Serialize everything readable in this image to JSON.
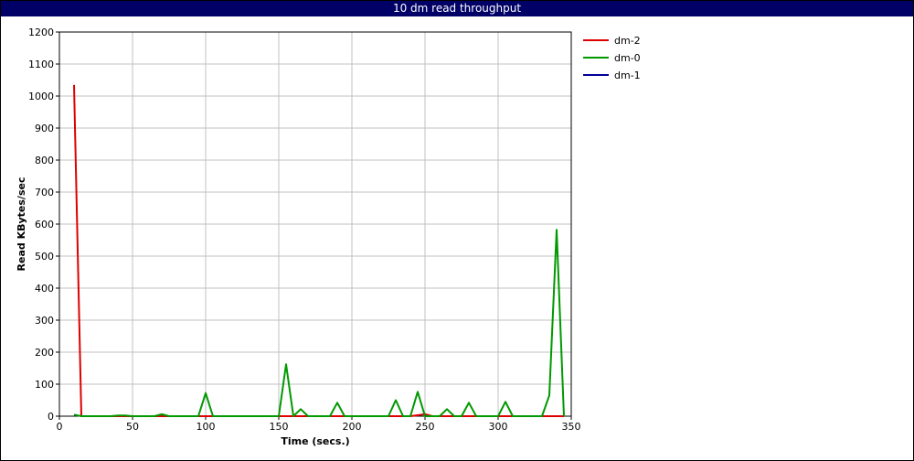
{
  "chart_data": {
    "type": "line",
    "title": "10 dm read throughput",
    "xlabel": "Time (secs.)",
    "ylabel": "Read KBytes/sec",
    "xlim": [
      0,
      350
    ],
    "ylim": [
      0,
      1200
    ],
    "x_ticks": [
      0,
      50,
      100,
      150,
      200,
      250,
      300,
      350
    ],
    "y_ticks": [
      0,
      100,
      200,
      300,
      400,
      500,
      600,
      700,
      800,
      900,
      1000,
      1100,
      1200
    ],
    "grid": true,
    "legend_position": "right",
    "series": [
      {
        "name": "dm-2",
        "color": "#dd0000",
        "points": [
          [
            10,
            1035
          ],
          [
            15,
            0
          ],
          [
            20,
            0
          ],
          [
            40,
            0
          ],
          [
            70,
            0
          ],
          [
            100,
            0
          ],
          [
            120,
            0
          ],
          [
            150,
            0
          ],
          [
            200,
            0
          ],
          [
            240,
            0
          ],
          [
            250,
            6
          ],
          [
            255,
            0
          ],
          [
            300,
            0
          ],
          [
            340,
            0
          ],
          [
            345,
            0
          ]
        ]
      },
      {
        "name": "dm-0",
        "color": "#009900",
        "points": [
          [
            10,
            5
          ],
          [
            15,
            0
          ],
          [
            35,
            0
          ],
          [
            40,
            2
          ],
          [
            45,
            2
          ],
          [
            50,
            0
          ],
          [
            65,
            0
          ],
          [
            70,
            6
          ],
          [
            75,
            0
          ],
          [
            95,
            0
          ],
          [
            100,
            72
          ],
          [
            105,
            0
          ],
          [
            150,
            0
          ],
          [
            155,
            162
          ],
          [
            160,
            0
          ],
          [
            165,
            22
          ],
          [
            170,
            0
          ],
          [
            185,
            0
          ],
          [
            190,
            42
          ],
          [
            195,
            0
          ],
          [
            225,
            0
          ],
          [
            230,
            50
          ],
          [
            235,
            0
          ],
          [
            240,
            0
          ],
          [
            245,
            76
          ],
          [
            250,
            0
          ],
          [
            260,
            0
          ],
          [
            265,
            22
          ],
          [
            270,
            0
          ],
          [
            275,
            0
          ],
          [
            280,
            42
          ],
          [
            285,
            0
          ],
          [
            300,
            0
          ],
          [
            305,
            45
          ],
          [
            310,
            0
          ],
          [
            330,
            0
          ],
          [
            335,
            65
          ],
          [
            340,
            582
          ],
          [
            345,
            0
          ]
        ]
      },
      {
        "name": "dm-1",
        "color": "#000099",
        "points": []
      }
    ]
  }
}
